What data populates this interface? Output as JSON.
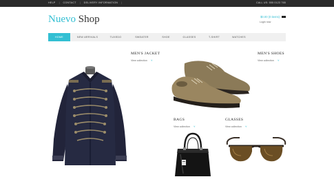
{
  "topbar": {
    "links": [
      "HELP",
      "CONTACT",
      "DELIVERY INFORMATION"
    ],
    "phone": "CALL US: 555 0123 765"
  },
  "logo": {
    "part1": "Nuevo",
    "part2": "Shop"
  },
  "cart": {
    "label": "$0.00 (0 items)",
    "icon": "cart-icon"
  },
  "login": {
    "label": "Login now"
  },
  "nav": {
    "items": [
      "HOME",
      "NEW ARRIVALS",
      "TUXEDO",
      "SWEATER",
      "SHOE",
      "GLASSES",
      "T-SHIRT",
      "WATCHES"
    ],
    "active": "HOME"
  },
  "products": {
    "jacket": {
      "title": "MEN'S JACKET",
      "link": "View collection"
    },
    "shoes": {
      "title": "MEN'S SHOES",
      "link": "View collection"
    },
    "bags": {
      "title": "BAGS",
      "link": "View collection"
    },
    "glasses": {
      "title": "GLASSES",
      "link": "View collection"
    }
  },
  "colors": {
    "accent": "#33bfd3",
    "topbar": "#2b2b2b",
    "nav_bg": "#f0f0f0"
  }
}
